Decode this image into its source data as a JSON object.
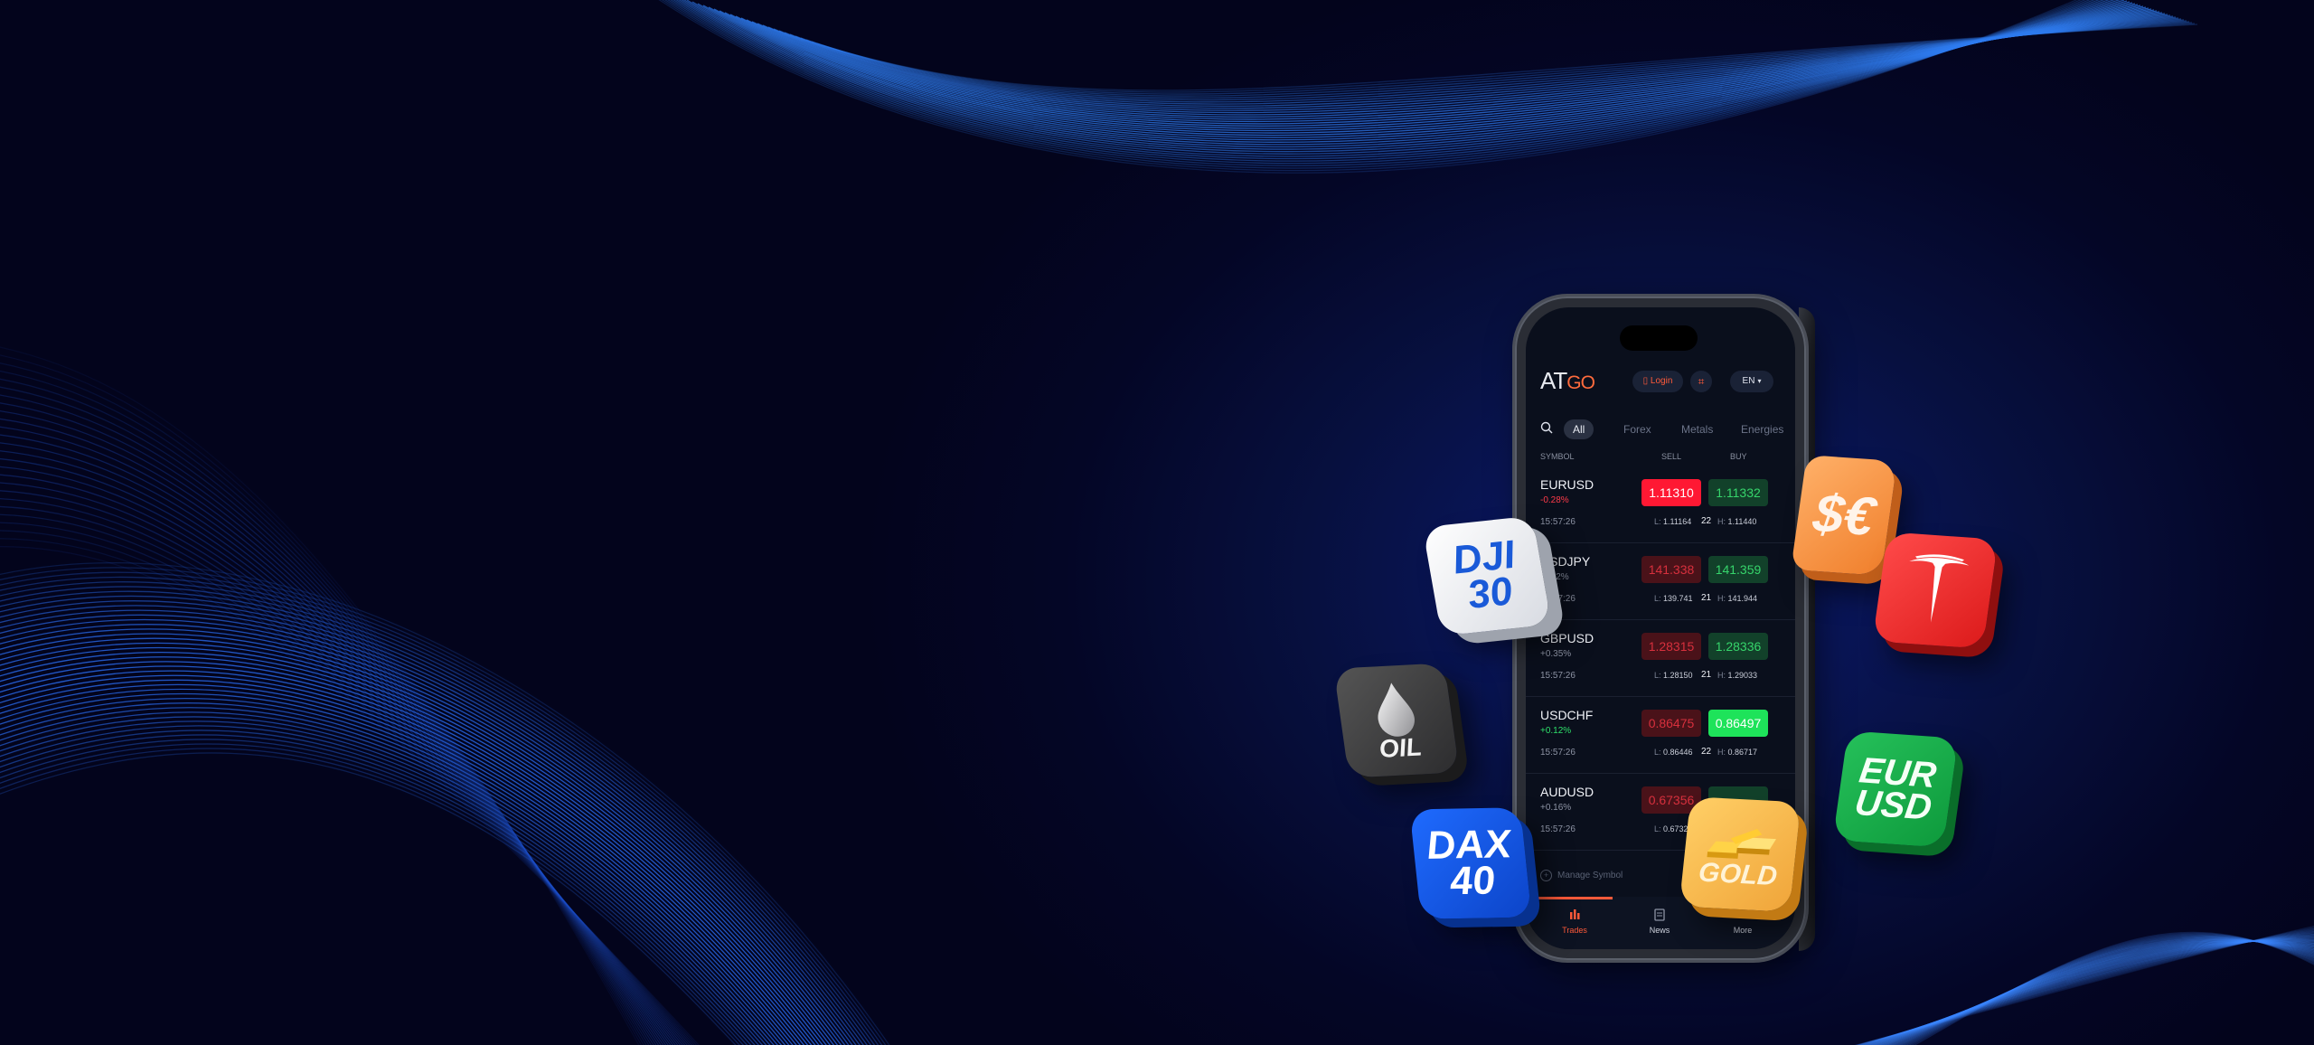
{
  "app": {
    "logo_at": "AT",
    "logo_go": "GO",
    "login_label": "Login",
    "language": "EN"
  },
  "tabs": [
    "All",
    "Forex",
    "Metals",
    "Energies"
  ],
  "columns": {
    "symbol": "SYMBOL",
    "sell": "SELL",
    "buy": "BUY"
  },
  "quotes": [
    {
      "symbol": "EURUSD",
      "change": "-0.28%",
      "time": "15:57:26",
      "sell": "1.11310",
      "buy": "1.11332",
      "low": "1.11164",
      "spread": "22",
      "high": "1.11440"
    },
    {
      "symbol": "USDJPY",
      "change": "-0.22%",
      "time": "15:57:26",
      "sell": "141.338",
      "buy": "141.359",
      "low": "139.741",
      "spread": "21",
      "high": "141.944"
    },
    {
      "symbol": "GBPUSD",
      "change": "+0.35%",
      "time": "15:57:26",
      "sell": "1.28315",
      "buy": "1.28336",
      "low": "1.28150",
      "spread": "21",
      "high": "1.29033"
    },
    {
      "symbol": "USDCHF",
      "change": "+0.12%",
      "time": "15:57:26",
      "sell": "0.86475",
      "buy": "0.86497",
      "low": "0.86446",
      "spread": "22",
      "high": "0.86717"
    },
    {
      "symbol": "AUDUSD",
      "change": "+0.16%",
      "time": "15:57:26",
      "sell": "0.67356",
      "buy": "",
      "low": "0.67321",
      "spread": "",
      "high": ""
    }
  ],
  "labels": {
    "low_prefix": "L:",
    "high_prefix": "H:"
  },
  "manage_symbol": "Manage Symbol",
  "bottom_nav": [
    {
      "label": "Trades",
      "icon": "candlestick-icon"
    },
    {
      "label": "News",
      "icon": "news-icon"
    },
    {
      "label": "More",
      "icon": "more-icon"
    }
  ],
  "tiles": {
    "dji": [
      "DJI",
      "30"
    ],
    "oil": "OIL",
    "dax": [
      "DAX",
      "40"
    ],
    "fx": "$€",
    "eurusd": [
      "EUR",
      "USD"
    ],
    "gold": "GOLD"
  },
  "colors": {
    "accent": "#ff5a3a",
    "sell_active": "#ff1833",
    "buy_active": "#1ee35a",
    "background": "#040626"
  }
}
